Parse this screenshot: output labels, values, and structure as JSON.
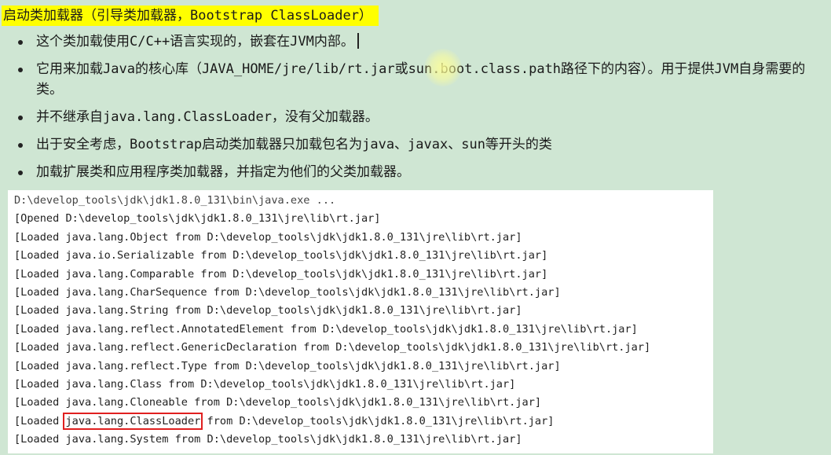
{
  "title": "启动类加载器（引导类加载器，Bootstrap ClassLoader）",
  "bullets": [
    {
      "text": "这个类加载使用C/C++语言实现的，嵌套在JVM内部。"
    },
    {
      "text": "它用来加载Java的核心库（JAVA_HOME/jre/lib/rt.jar或sun.boot.class.path路径下的内容）。用于提供JVM自身需要的类。"
    },
    {
      "text": "并不继承自java.lang.ClassLoader，没有父加载器。"
    },
    {
      "text": "出于安全考虑，Bootstrap启动类加载器只加载包名为java、javax、sun等开头的类"
    },
    {
      "text": "加载扩展类和应用程序类加载器，并指定为他们的父类加载器。"
    }
  ],
  "console": {
    "command": "D:\\develop_tools\\jdk\\jdk1.8.0_131\\bin\\java.exe ...",
    "lines": [
      "[Opened D:\\develop_tools\\jdk\\jdk1.8.0_131\\jre\\lib\\rt.jar]",
      "[Loaded java.lang.Object from D:\\develop_tools\\jdk\\jdk1.8.0_131\\jre\\lib\\rt.jar]",
      "[Loaded java.io.Serializable from D:\\develop_tools\\jdk\\jdk1.8.0_131\\jre\\lib\\rt.jar]",
      "[Loaded java.lang.Comparable from D:\\develop_tools\\jdk\\jdk1.8.0_131\\jre\\lib\\rt.jar]",
      "[Loaded java.lang.CharSequence from D:\\develop_tools\\jdk\\jdk1.8.0_131\\jre\\lib\\rt.jar]",
      "[Loaded java.lang.String from D:\\develop_tools\\jdk\\jdk1.8.0_131\\jre\\lib\\rt.jar]",
      "[Loaded java.lang.reflect.AnnotatedElement from D:\\develop_tools\\jdk\\jdk1.8.0_131\\jre\\lib\\rt.jar]",
      "[Loaded java.lang.reflect.GenericDeclaration from D:\\develop_tools\\jdk\\jdk1.8.0_131\\jre\\lib\\rt.jar]",
      "[Loaded java.lang.reflect.Type from D:\\develop_tools\\jdk\\jdk1.8.0_131\\jre\\lib\\rt.jar]",
      "[Loaded java.lang.Class from D:\\develop_tools\\jdk\\jdk1.8.0_131\\jre\\lib\\rt.jar]",
      "[Loaded java.lang.Cloneable from D:\\develop_tools\\jdk\\jdk1.8.0_131\\jre\\lib\\rt.jar]"
    ],
    "boxed_line": {
      "prefix": "[Loaded ",
      "boxed": "java.lang.ClassLoader",
      "suffix": " from D:\\develop_tools\\jdk\\jdk1.8.0_131\\jre\\lib\\rt.jar]"
    },
    "last_line": "[Loaded java.lang.System from D:\\develop_tools\\jdk\\jdk1.8.0_131\\jre\\lib\\rt.jar]"
  },
  "colors": {
    "background": "#cfe6d3",
    "title_highlight": "#ffff00",
    "box_outline": "#e02020"
  }
}
